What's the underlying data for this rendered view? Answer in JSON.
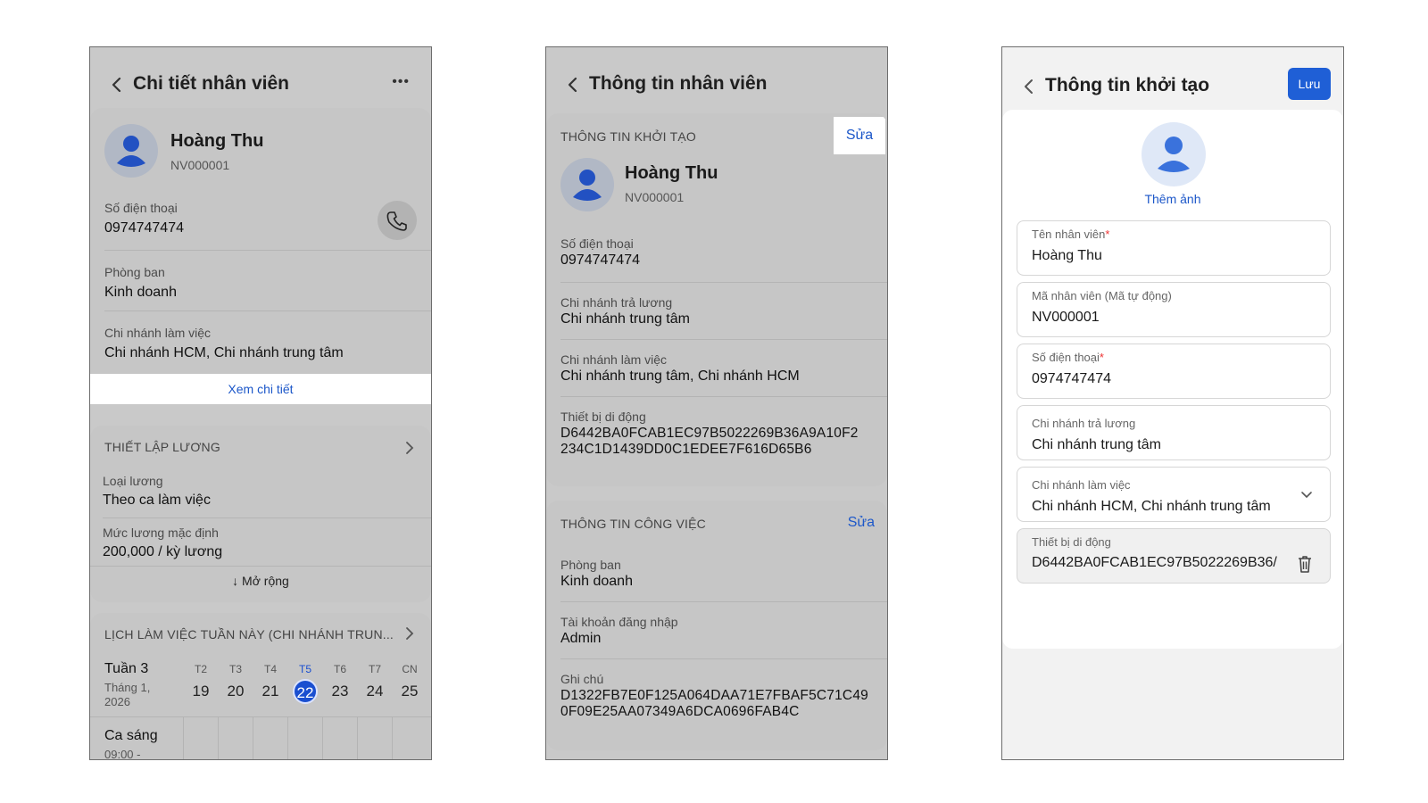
{
  "screen1": {
    "title": "Chi tiết nhân viên",
    "more_label": "•••",
    "employee": {
      "name": "Hoàng Thu",
      "code": "NV000001"
    },
    "phone": {
      "label": "Số điện thoại",
      "value": "0974747474"
    },
    "department": {
      "label": "Phòng ban",
      "value": "Kinh doanh"
    },
    "work_branch": {
      "label": "Chi nhánh làm việc",
      "value": "Chi nhánh HCM, Chi nhánh trung tâm"
    },
    "view_detail": "Xem chi tiết",
    "salary": {
      "section": "THIẾT LẬP LƯƠNG",
      "type_label": "Loại lương",
      "type_value": "Theo ca làm việc",
      "default_label": "Mức lương mặc định",
      "default_value": "200,000 / kỳ lương",
      "expand": "↓ Mở rộng"
    },
    "schedule": {
      "section": "LỊCH LÀM VIỆC TUẦN NÀY (CHI NHÁNH TRUN...",
      "week": "Tuần 3",
      "month": "Tháng 1,",
      "year": "2026",
      "days": [
        {
          "label": "T2",
          "num": "19"
        },
        {
          "label": "T3",
          "num": "20"
        },
        {
          "label": "T4",
          "num": "21"
        },
        {
          "label": "T5",
          "num": "22"
        },
        {
          "label": "T6",
          "num": "23"
        },
        {
          "label": "T7",
          "num": "24"
        },
        {
          "label": "CN",
          "num": "25"
        }
      ],
      "selected_day_index": 3,
      "shift_name": "Ca sáng",
      "shift_time": "09:00 -",
      "check": "✓"
    }
  },
  "screen2": {
    "title": "Thông tin nhân viên",
    "init_section": "THÔNG TIN KHỞI TẠO",
    "edit": "Sửa",
    "employee": {
      "name": "Hoàng Thu",
      "code": "NV000001"
    },
    "phone": {
      "label": "Số điện thoại",
      "value": "0974747474"
    },
    "pay_branch": {
      "label": "Chi nhánh trả lương",
      "value": "Chi nhánh trung tâm"
    },
    "work_branch": {
      "label": "Chi nhánh làm việc",
      "value": "Chi nhánh trung tâm, Chi nhánh HCM"
    },
    "device": {
      "label": "Thiết bị di động",
      "value1": "D6442BA0FCAB1EC97B5022269B36A9A10F2",
      "value2": "234C1D1439DD0C1EDEE7F616D65B6"
    },
    "job_section": "THÔNG TIN CÔNG VIỆC",
    "department": {
      "label": "Phòng ban",
      "value": "Kinh doanh"
    },
    "login": {
      "label": "Tài khoản đăng nhập",
      "value": "Admin"
    },
    "note": {
      "label": "Ghi chú",
      "value1": "D1322FB7E0F125A064DAA71E7FBAF5C71C49",
      "value2": "0F09E25AA07349A6DCA0696FAB4C"
    }
  },
  "screen3": {
    "title": "Thông tin khởi tạo",
    "save": "Lưu",
    "add_photo": "Thêm ảnh",
    "fields": {
      "name": {
        "label": "Tên nhân viên",
        "value": "Hoàng Thu",
        "required": "*"
      },
      "code": {
        "label": "Mã nhân viên (Mã tự động)",
        "value": "NV000001"
      },
      "phone": {
        "label": "Số điện thoại",
        "value": "0974747474",
        "required": "*"
      },
      "pay_branch": {
        "label": "Chi nhánh trả lương",
        "value": "Chi nhánh trung tâm"
      },
      "work_branch": {
        "label": "Chi nhánh làm việc",
        "value": "Chi nhánh HCM, Chi nhánh trung tâm"
      },
      "device": {
        "label": "Thiết bị di động",
        "value": "D6442BA0FCAB1EC97B5022269B36/"
      }
    }
  },
  "colors": {
    "accent": "#1c57c9",
    "save_button": "#1f5fd6",
    "overlay_bg": "#c9c9c9"
  }
}
